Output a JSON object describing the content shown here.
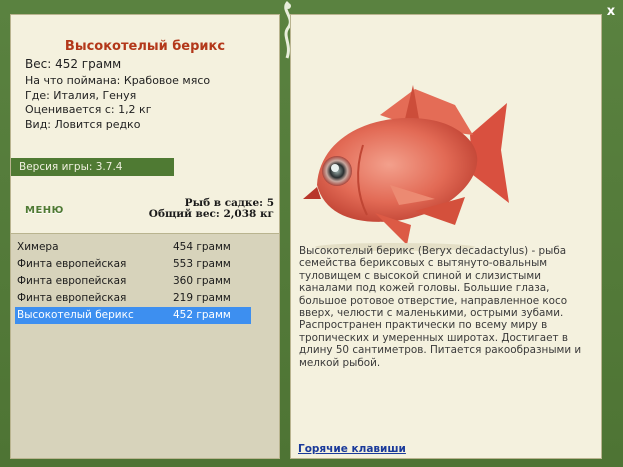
{
  "window": {
    "close_label": "x"
  },
  "fish": {
    "name": "Высокотелый берикс",
    "weight": "Вес: 452 грамм",
    "bait": "На что поймана: Крабовое мясо",
    "location": "Где: Италия, Генуя",
    "value": "Оценивается с: 1,2 кг",
    "rarity": "Вид: Ловится редко",
    "description": "Высокотелый берикс (Beryx decadactylus) - рыба семейства бериксовых с вытянуто-овальным туловищем с высокой спиной и слизистыми каналами под кожей головы. Большие глаза, большое ротовое отверстие, направленное косо вверх, челюсти с маленькими, острыми зубами. Распространен практически по всему миру в тропических и умеренных широтах. Достигает в длину 50 сантиметров. Питается ракообразными и мелкой рыбой."
  },
  "version": "Версия игры: 3.7.4",
  "menu_label": "МЕНЮ",
  "stats": {
    "count": "Рыб в садке: 5",
    "total": "Общий вес: 2,038 кг"
  },
  "catch": [
    {
      "name": "Химера",
      "weight": "454 грамм"
    },
    {
      "name": "Финта европейская",
      "weight": "553 грамм"
    },
    {
      "name": "Финта европейская",
      "weight": "360 грамм"
    },
    {
      "name": "Финта европейская",
      "weight": "219 грамм"
    },
    {
      "name": "Высокотелый берикс",
      "weight": "452 грамм"
    }
  ],
  "selected_index": 4,
  "hotkeys_label": "Горячие клавиши",
  "colors": {
    "frame": "#547a3a",
    "panel": "#f4f1de",
    "accent_green": "#4f7a33",
    "title_red": "#b3381a",
    "selection": "#3d8ff0",
    "link": "#1a3a9a"
  }
}
